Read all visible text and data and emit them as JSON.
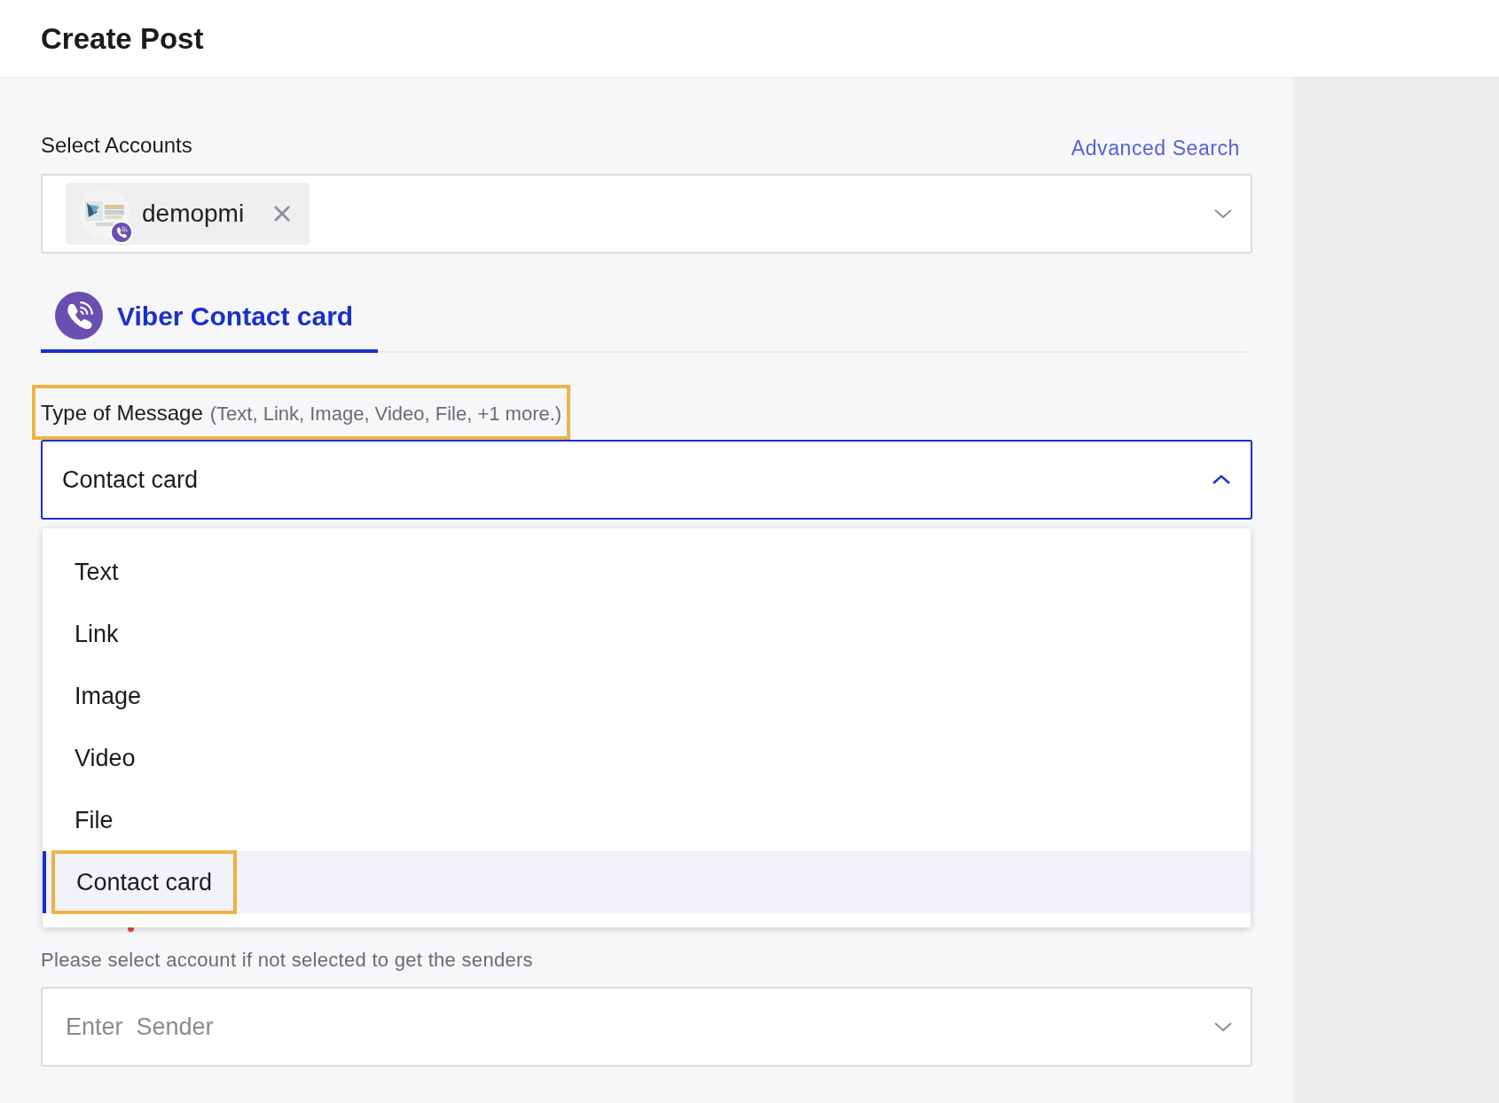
{
  "header": {
    "title": "Create Post"
  },
  "accounts": {
    "label": "Select Accounts",
    "advanced_link": "Advanced Search",
    "chips": [
      {
        "name": "demopmi"
      }
    ]
  },
  "tabs": [
    {
      "label": "Viber Contact card",
      "selected": true
    }
  ],
  "message_type": {
    "label": "Type of Message",
    "hint": "(Text, Link, Image, Video, File, +1 more.)",
    "value": "Contact card",
    "expanded": true,
    "options": [
      {
        "label": "Text",
        "selected": false
      },
      {
        "label": "Link",
        "selected": false
      },
      {
        "label": "Image",
        "selected": false
      },
      {
        "label": "Video",
        "selected": false
      },
      {
        "label": "File",
        "selected": false
      },
      {
        "label": "Contact card",
        "selected": true
      }
    ]
  },
  "sender": {
    "required": true,
    "hint": "Please select account if not selected to get the senders",
    "placeholder": "Enter  Sender"
  }
}
